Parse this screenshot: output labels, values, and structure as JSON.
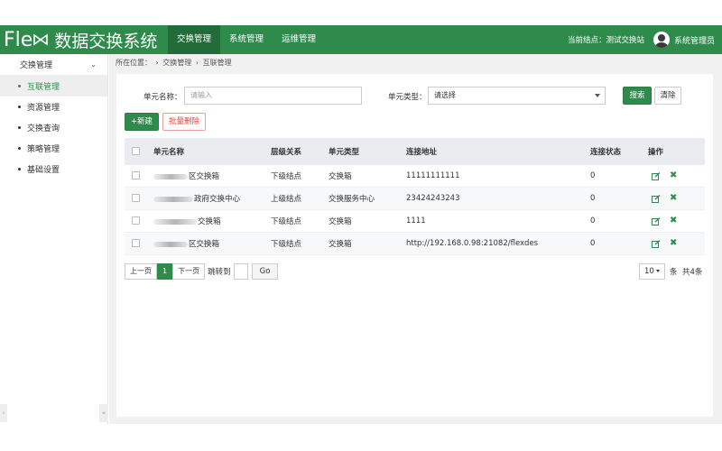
{
  "header": {
    "logo_prefix": "Fle",
    "app_title": "数据交换系统",
    "nav": [
      {
        "label": "交换管理"
      },
      {
        "label": "系统管理"
      },
      {
        "label": "运维管理"
      }
    ],
    "current_node_label": "当前结点：测试交换站",
    "user_name": "系统管理员",
    "user_icon": "user-avatar-icon"
  },
  "sidebar": {
    "group_label": "交换管理",
    "items": [
      {
        "label": "互联管理"
      },
      {
        "label": "资源管理"
      },
      {
        "label": "交换查询"
      },
      {
        "label": "策略管理"
      },
      {
        "label": "基础设置"
      }
    ]
  },
  "breadcrumb": {
    "prefix": "所在位置：",
    "parts": [
      "交换管理",
      "互联管理"
    ]
  },
  "search": {
    "name_label": "单元名称：",
    "name_placeholder": "请输入",
    "type_label": "单元类型：",
    "type_value": "请选择",
    "search_button": "搜索",
    "clear_button": "清除"
  },
  "actions": {
    "new_button": "+新建",
    "batch_delete_button": "批量删除"
  },
  "table": {
    "headers": {
      "name": "单元名称",
      "level": "层级关系",
      "type": "单元类型",
      "address": "连接地址",
      "status": "连接状态",
      "ops": "操作"
    },
    "rows": [
      {
        "name_visible": "区交换箱",
        "level": "下级结点",
        "type": "交换箱",
        "address": "11111111111",
        "status": "0"
      },
      {
        "name_visible": "政府交换中心",
        "level": "上级结点",
        "type": "交换服务中心",
        "address": "23424243243",
        "status": "0"
      },
      {
        "name_visible": "交换箱",
        "level": "下级结点",
        "type": "交换箱",
        "address": "1111",
        "status": "0"
      },
      {
        "name_visible": "区交换箱",
        "level": "下级结点",
        "type": "交换箱",
        "address": "http://192.168.0.98:21082/flexdes",
        "status": "0"
      }
    ]
  },
  "pager": {
    "prev": "上一页",
    "current": "1",
    "next": "下一页",
    "jump_label": "跳转到",
    "go": "Go",
    "page_size": "10",
    "unit": "条",
    "total": "共4条"
  },
  "colors": {
    "brand_green": "#2e8b4b",
    "danger_red": "#e0453a"
  }
}
